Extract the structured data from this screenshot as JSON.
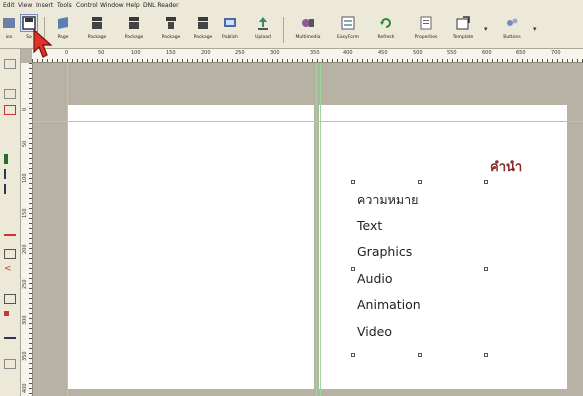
{
  "menu": [
    "Edit",
    "View",
    "Insert",
    "Tools",
    "Control",
    "Window",
    "Help",
    "DNL Reader"
  ],
  "toolbar": {
    "left_partial": "ion",
    "save_partial": "Sa",
    "buttons": [
      "Page",
      "Package",
      "Package",
      "Package",
      "Package",
      "Publish",
      "Upload",
      "Multimedia",
      "EasyForm",
      "Refresh",
      "Properties",
      "Template",
      "Buttons"
    ]
  },
  "ruler": {
    "h_labels": [
      "0",
      "50",
      "100",
      "150",
      "200",
      "250",
      "300",
      "350",
      "400",
      "450",
      "500",
      "550",
      "600",
      "650",
      "700"
    ],
    "v_labels": [
      "0",
      "50",
      "100",
      "150",
      "200",
      "250",
      "300",
      "350",
      "400"
    ],
    "top_partial": "50"
  },
  "canvas": {
    "title": "คำนำ",
    "items": [
      "ความหมาย",
      "Text",
      "Graphics",
      "Audio",
      "Animation",
      "Video"
    ]
  },
  "colors": {
    "title": "#8a2b2b",
    "guide": "#9fd49f",
    "cursor": "#e0322a"
  },
  "icons": [
    "save-icon",
    "page-icon",
    "package-icon",
    "publish-icon",
    "upload-icon",
    "multimedia-icon",
    "easyform-icon",
    "refresh-icon",
    "properties-icon",
    "template-icon",
    "buttons-icon",
    "pointer-cursor-icon"
  ]
}
